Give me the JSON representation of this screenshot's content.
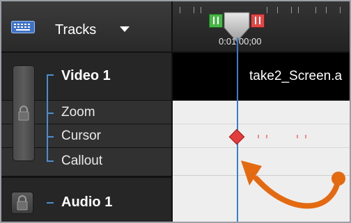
{
  "header": {
    "tracks_label": "Tracks",
    "tracks_icon": "keyboard-icon",
    "dropdown_icon": "triangle-down-icon"
  },
  "timeline": {
    "time_readout": "0:01:00;00",
    "in_marker_color": "#49b649",
    "out_marker_color": "#e04848",
    "playhead_color": "#3a7ec8"
  },
  "tracks": {
    "video": {
      "name": "Video 1",
      "clip_label": "take2_Screen.a"
    },
    "sub_tracks": [
      {
        "label": "Zoom"
      },
      {
        "label": "Cursor"
      },
      {
        "label": "Callout"
      }
    ],
    "audio": {
      "name": "Audio 1"
    }
  },
  "colors": {
    "accent_tree": "#4a8fd0",
    "keyframe": "#e23c3c",
    "annotation_arrow": "#e46a12"
  }
}
